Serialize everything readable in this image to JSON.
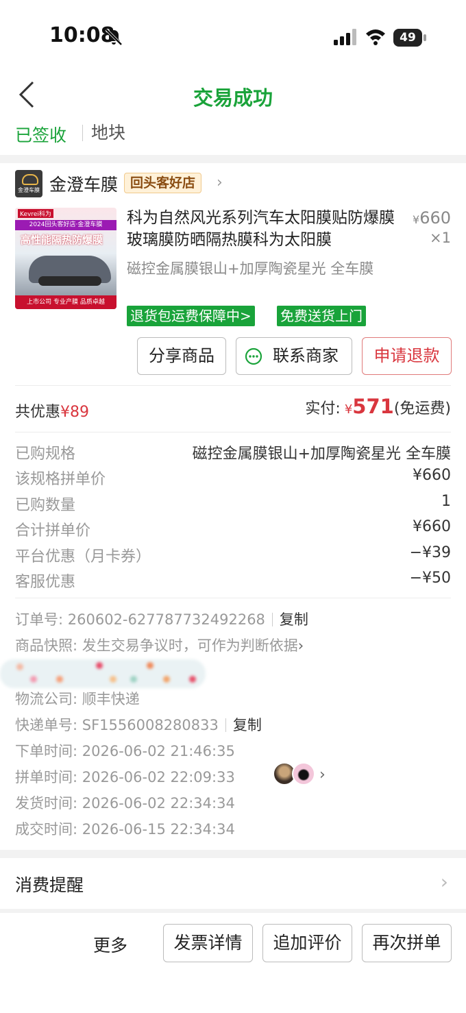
{
  "status_bar": {
    "time": "10:08",
    "battery": "49"
  },
  "nav": {
    "title": "交易成功"
  },
  "delivery": {
    "status": "已签收",
    "address": "地块"
  },
  "shop": {
    "logo_text": "金澄车膜",
    "name": "金澄车膜",
    "badge": "回头客好店"
  },
  "product": {
    "thumb": {
      "top": "Kevrei科为",
      "band": "2024回头客好店·金澄车膜",
      "big": "高性能隔热防爆膜",
      "bottom": "上市公司  专业产膜  品质卓越"
    },
    "title": "科为自然风光系列汽车太阳膜贴防爆膜玻璃膜防晒隔热膜科为太阳膜",
    "price_symbol": "¥",
    "price": "660",
    "quantity": "×1",
    "spec": "磁控金属膜银山+加厚陶瓷星光 全车膜",
    "tags": [
      "退货包运费保障中>",
      "免费送货上门"
    ]
  },
  "actions": {
    "share": "分享商品",
    "contact": "联系商家",
    "refund": "申请退款"
  },
  "summary": {
    "discount_label": "共优惠",
    "discount_value": "¥89",
    "paid_label": "实付:",
    "paid_currency": "¥",
    "paid_amount": "571",
    "shipping_note": "(免运费)"
  },
  "details": [
    {
      "label": "已购规格",
      "value": "磁控金属膜银山+加厚陶瓷星光 全车膜"
    },
    {
      "label": "该规格拼单价",
      "value": "¥660"
    },
    {
      "label": "已购数量",
      "value": "1"
    },
    {
      "label": "合计拼单价",
      "value": "¥660"
    },
    {
      "label": "平台优惠（月卡券）",
      "value": "−¥39"
    },
    {
      "label": "客服优惠",
      "value": "−¥50"
    }
  ],
  "order_info": {
    "order_no_label": "订单号:",
    "order_no": "260602-627787732492268",
    "copy": "复制",
    "snapshot_label": "商品快照:",
    "snapshot_text": "发生交易争议时，可作为判断依据",
    "logistics_label": "物流公司:",
    "logistics": "顺丰快递",
    "tracking_label": "快递单号:",
    "tracking_no": "SF1556008280833",
    "order_time_label": "下单时间:",
    "order_time": "2026-06-02 21:46:35",
    "group_time_label": "拼单时间:",
    "group_time": "2026-06-02 22:09:33",
    "ship_time_label": "发货时间:",
    "ship_time": "2026-06-02 22:34:34",
    "deal_time_label": "成交时间:",
    "deal_time": "2026-06-15 22:34:34"
  },
  "reminder": {
    "label": "消费提醒"
  },
  "bottom_bar": {
    "more": "更多",
    "invoice": "发票详情",
    "review": "追加评价",
    "rebuy": "再次拼单"
  },
  "colors": {
    "brand_green": "#1aa33a",
    "price_red": "#d9363e"
  }
}
